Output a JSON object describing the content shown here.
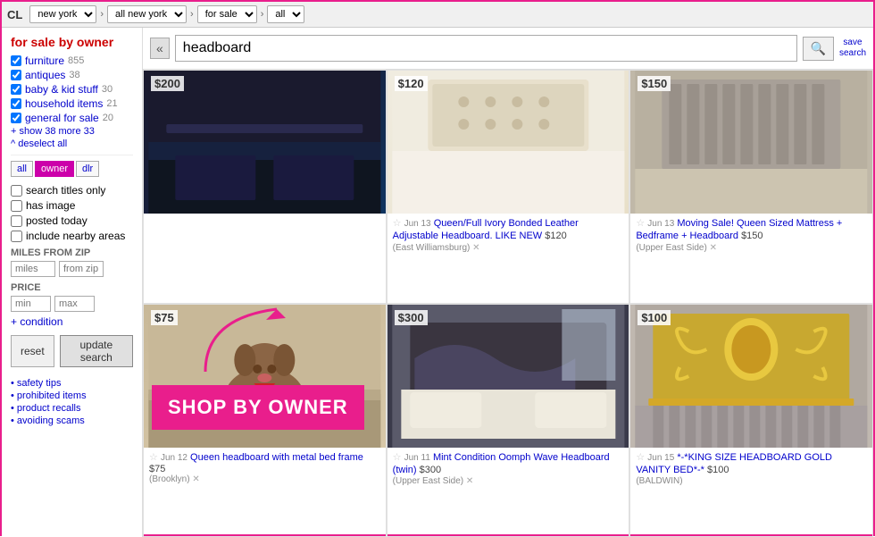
{
  "topbar": {
    "logo": "CL",
    "location1": "new york",
    "location2": "all new york",
    "category": "for sale",
    "subcategory": "all"
  },
  "sidebar": {
    "title": "for sale by owner",
    "categories": [
      {
        "label": "furniture",
        "count": "855",
        "checked": true
      },
      {
        "label": "antiques",
        "count": "38",
        "checked": true
      },
      {
        "label": "baby & kid stuff",
        "count": "30",
        "checked": true
      },
      {
        "label": "household items",
        "count": "21",
        "checked": true
      },
      {
        "label": "general for sale",
        "count": "20",
        "checked": true
      }
    ],
    "show_more": "+ show 38 more",
    "show_more_count": "33",
    "deselect_all": "^ deselect all",
    "filter_tabs": [
      "all",
      "owner",
      "dlr"
    ],
    "active_tab": "owner",
    "checkboxes": [
      {
        "label": "search titles only"
      },
      {
        "label": "has image"
      },
      {
        "label": "posted today"
      },
      {
        "label": "include nearby areas"
      }
    ],
    "miles_label": "MILES FROM ZIP",
    "miles_placeholder": "miles",
    "zip_placeholder": "from zip",
    "price_label": "PRICE",
    "min_placeholder": "min",
    "max_placeholder": "max",
    "condition_label": "+ condition",
    "reset_label": "reset",
    "update_label": "update search",
    "footer_links": [
      "safety tips",
      "prohibited items",
      "product recalls",
      "avoiding scams"
    ]
  },
  "search": {
    "query": "headboard",
    "placeholder": "search",
    "save_line1": "save",
    "save_line2": "search"
  },
  "overlay": {
    "text": "SHOP BY OWNER"
  },
  "listings": [
    {
      "price": "$200",
      "img_type": "dark",
      "date": "",
      "title": "",
      "price_tag": "",
      "location": ""
    },
    {
      "price": "$120",
      "img_type": "light",
      "date": "Jun 13",
      "title": "Queen/Full Ivory Bonded Leather Adjustable Headboard. LIKE NEW",
      "price_tag": "$120",
      "location": "(East Williamsburg)"
    },
    {
      "price": "$150",
      "img_type": "gray",
      "date": "Jun 13",
      "title": "Moving Sale! Queen Sized Mattress + Bedframe + Headboard",
      "price_tag": "$150",
      "location": "(Upper East Side)"
    },
    {
      "price": "$75",
      "img_type": "dog",
      "date": "Jun 12",
      "title": "Queen headboard with metal bed frame",
      "price_tag": "$75",
      "location": "(Brooklyn)"
    },
    {
      "price": "$300",
      "img_type": "room",
      "date": "Jun 11",
      "title": "Mint Condition Oomph Wave Headboard (twin)",
      "price_tag": "$300",
      "location": "(Upper East Side)"
    },
    {
      "price": "$100",
      "img_type": "gold",
      "date": "Jun 15",
      "title": "*-*KING SIZE HEADBOARD GOLD VANITY BED*-*",
      "price_tag": "$100",
      "location": "(BALDWIN)"
    }
  ]
}
